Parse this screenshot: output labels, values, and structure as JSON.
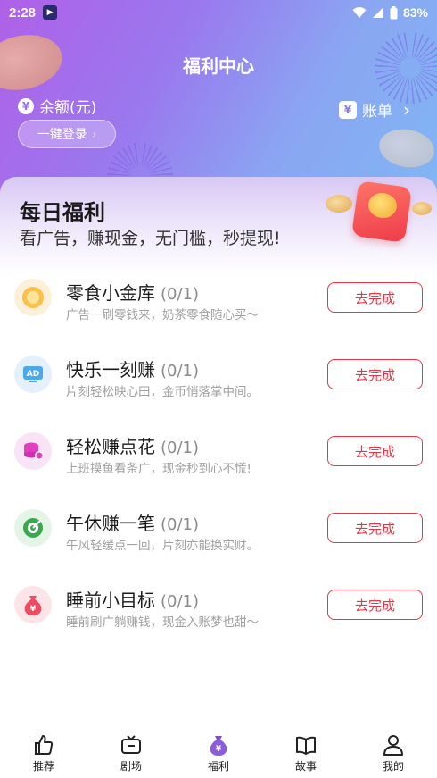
{
  "status_bar": {
    "time": "2:28",
    "battery": "83%"
  },
  "header": {
    "title": "福利中心",
    "balance_label": "余额(元)",
    "login_label": "一键登录",
    "bill_label": "账单"
  },
  "daily": {
    "title": "每日福利",
    "subtitle": "看广告，赚现金，无门槛，秒提现!"
  },
  "tasks": [
    {
      "name": "零食小金库",
      "progress": "(0/1)",
      "desc": "广告一刷零钱来，奶茶零食随心买～",
      "button": "去完成",
      "icon": "coin-icon"
    },
    {
      "name": "快乐一刻赚",
      "progress": "(0/1)",
      "desc": "片刻轻松映心田，金币悄落掌中间。",
      "button": "去完成",
      "icon": "ad-icon"
    },
    {
      "name": "轻松赚点花",
      "progress": "(0/1)",
      "desc": "上班摸鱼看条广，现金秒到心不慌!",
      "button": "去完成",
      "icon": "coin-stack-icon"
    },
    {
      "name": "午休赚一笔",
      "progress": "(0/1)",
      "desc": "午风轻缓点一回，片刻亦能换实财。",
      "button": "去完成",
      "icon": "target-icon"
    },
    {
      "name": "睡前小目标",
      "progress": "(0/1)",
      "desc": "睡前刷广躺赚钱，现金入账梦也甜～",
      "button": "去完成",
      "icon": "money-bag-icon"
    }
  ],
  "bottom_nav": [
    {
      "label": "推荐",
      "icon": "thumbs-up-icon"
    },
    {
      "label": "剧场",
      "icon": "tv-icon"
    },
    {
      "label": "福利",
      "icon": "money-bag-icon"
    },
    {
      "label": "故事",
      "icon": "book-icon"
    },
    {
      "label": "我的",
      "icon": "user-icon"
    }
  ],
  "colors": {
    "accent_red": "#ee3344",
    "hero_gradient_start": "#b060e8",
    "hero_gradient_end": "#7fb8f4"
  }
}
